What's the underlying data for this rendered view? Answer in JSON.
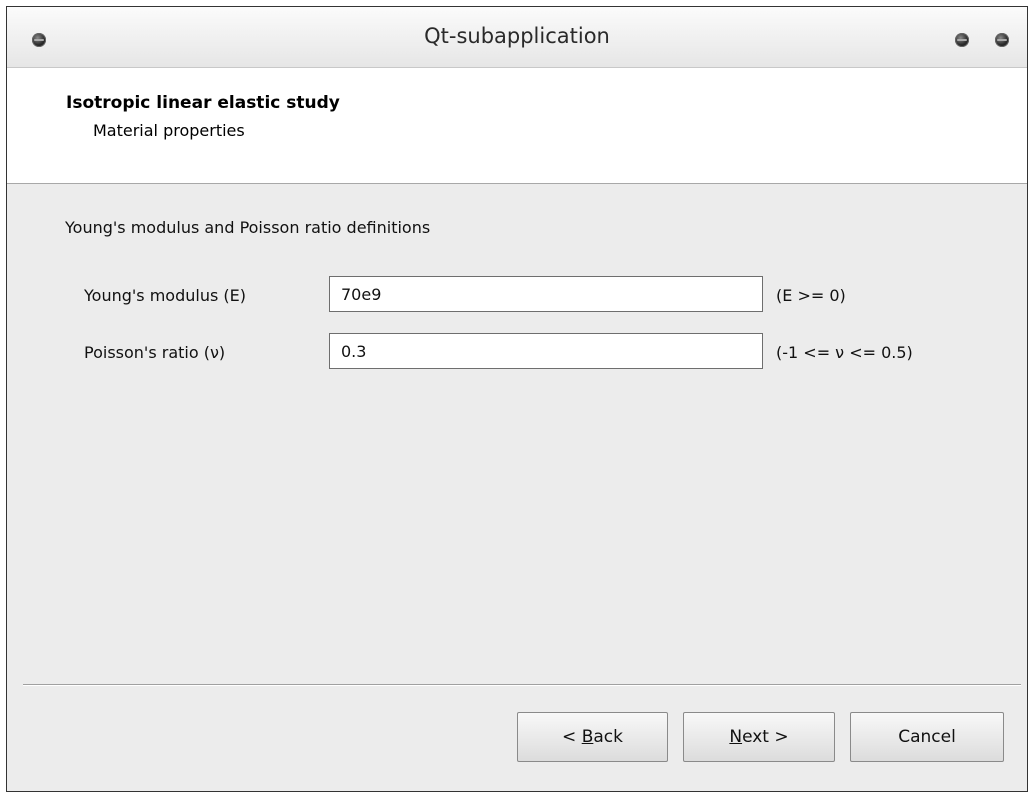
{
  "window": {
    "title": "Qt-subapplication"
  },
  "header": {
    "title": "Isotropic linear elastic study",
    "subtitle": "Material properties"
  },
  "group": {
    "title": "Young's modulus and Poisson ratio definitions"
  },
  "fields": [
    {
      "label": "Young's modulus (E)",
      "value": "70e9",
      "range": "(E >= 0)"
    },
    {
      "label": "Poisson's ratio (ν)",
      "value": "0.3",
      "range": "(-1 <= ν <= 0.5)"
    }
  ],
  "buttons": {
    "back_prefix": "< ",
    "back_mnemonic": "B",
    "back_rest": "ack",
    "next_mnemonic": "N",
    "next_rest": "ext >",
    "cancel": "Cancel"
  },
  "icons": {
    "menu": "window-menu-icon",
    "minimize": "minimize-icon",
    "close": "close-icon"
  }
}
